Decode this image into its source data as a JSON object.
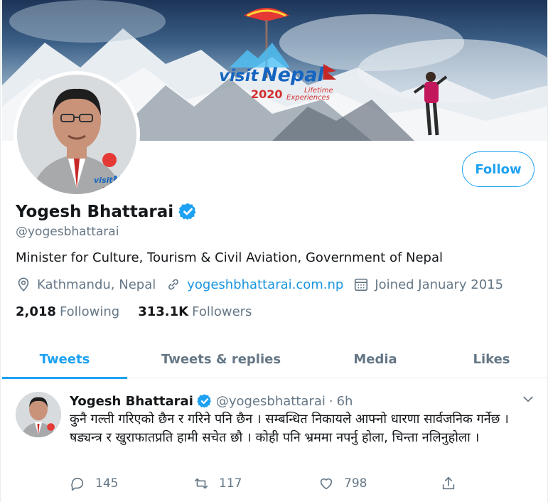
{
  "banner": {
    "logo_visit": "visit",
    "logo_nepal": "Nepal",
    "logo_year": "2020",
    "logo_tagline_1": "Lifetime",
    "logo_tagline_2": "Experiences"
  },
  "profile": {
    "name": "Yogesh Bhattarai",
    "handle": "@yogesbhattarai",
    "bio": "Minister for Culture, Tourism & Civil Aviation, Government of Nepal",
    "location": "Kathmandu, Nepal",
    "website": "yogeshbhattarai.com.np",
    "joined": "Joined January 2015",
    "following_count": "2,018",
    "following_label": "Following",
    "followers_count": "313.1K",
    "followers_label": "Followers",
    "follow_button": "Follow"
  },
  "tabs": [
    {
      "label": "Tweets",
      "active": true
    },
    {
      "label": "Tweets & replies",
      "active": false
    },
    {
      "label": "Media",
      "active": false
    },
    {
      "label": "Likes",
      "active": false
    }
  ],
  "tweet": {
    "author": "Yogesh Bhattarai",
    "handle": "@yogesbhattarai",
    "separator": "·",
    "time": "6h",
    "text": "कुनै गल्ती गरिएको छैन र गरिने पनि छैन । सम्बन्धित निकायले आफ्नो धारणा सार्वजनिक गर्नेछ । षड्यन्त्र र खुराफातप्रति हामी सचेत छौ । कोही पनि भ्रममा नपर्नु होला, चिन्ता नलिनुहोला ।",
    "replies": "145",
    "retweets": "117",
    "likes": "798"
  },
  "colors": {
    "accent": "#1da1f2",
    "link": "#1b95e0",
    "secondary_text": "#657786",
    "primary_text": "#14171a"
  }
}
